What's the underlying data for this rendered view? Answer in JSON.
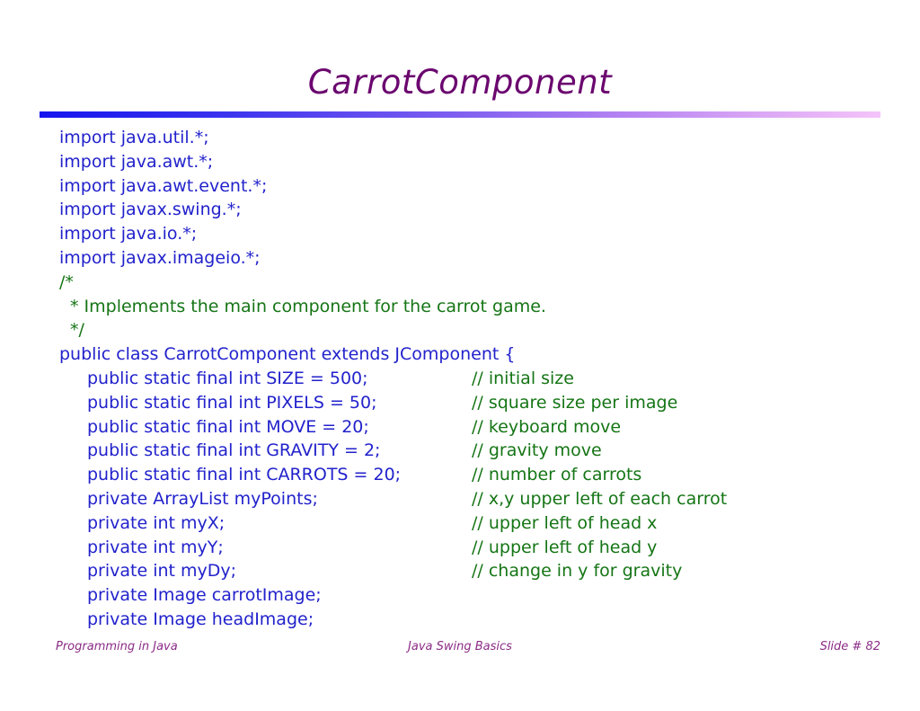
{
  "slide": {
    "title": "CarrotComponent",
    "colors": {
      "title": "#6b066f",
      "code": "#2222cc",
      "comment": "#157515",
      "footer": "#8b2c87",
      "rule_start": "#1414ee",
      "rule_end": "#f4c4fa",
      "background": "#ffffff"
    }
  },
  "code": {
    "lines": [
      {
        "text": "import java.util.*;",
        "indent": 0,
        "kind": "code",
        "comment": ""
      },
      {
        "text": "import java.awt.*;",
        "indent": 0,
        "kind": "code",
        "comment": ""
      },
      {
        "text": "import java.awt.event.*;",
        "indent": 0,
        "kind": "code",
        "comment": ""
      },
      {
        "text": "import javax.swing.*;",
        "indent": 0,
        "kind": "code",
        "comment": ""
      },
      {
        "text": "import java.io.*;",
        "indent": 0,
        "kind": "code",
        "comment": ""
      },
      {
        "text": "import javax.imageio.*;",
        "indent": 0,
        "kind": "code",
        "comment": ""
      },
      {
        "text": "/*",
        "indent": 0,
        "kind": "comment",
        "comment": ""
      },
      {
        "text": "* Implements the main component for the carrot game.",
        "indent": 2,
        "kind": "comment",
        "comment": ""
      },
      {
        "text": "*/",
        "indent": 2,
        "kind": "comment",
        "comment": ""
      },
      {
        "text": "public class CarrotComponent extends JComponent {",
        "indent": 0,
        "kind": "code",
        "comment": ""
      },
      {
        "text": "public static final int SIZE = 500;",
        "indent": 1,
        "kind": "code",
        "comment": "// initial size"
      },
      {
        "text": "public static final int PIXELS = 50;",
        "indent": 1,
        "kind": "code",
        "comment": "// square size per image"
      },
      {
        "text": "public static final int MOVE = 20;",
        "indent": 1,
        "kind": "code",
        "comment": "// keyboard move"
      },
      {
        "text": "public static final int GRAVITY = 2;",
        "indent": 1,
        "kind": "code",
        "comment": "// gravity move"
      },
      {
        "text": "public static final int CARROTS = 20;",
        "indent": 1,
        "kind": "code",
        "comment": "// number of carrots"
      },
      {
        "text": "private ArrayList myPoints;",
        "indent": 1,
        "kind": "code",
        "comment": "// x,y upper left of each carrot"
      },
      {
        "text": "private int myX;",
        "indent": 1,
        "kind": "code",
        "comment": "// upper left of head x"
      },
      {
        "text": "private int myY;",
        "indent": 1,
        "kind": "code",
        "comment": "// upper left of head y"
      },
      {
        "text": "private int myDy;",
        "indent": 1,
        "kind": "code",
        "comment": "// change in y for gravity"
      },
      {
        "text": "private Image carrotImage;",
        "indent": 1,
        "kind": "code",
        "comment": ""
      },
      {
        "text": "private Image headImage;",
        "indent": 1,
        "kind": "code",
        "comment": ""
      }
    ]
  },
  "footer": {
    "left": "Programming in Java",
    "center": "Java Swing Basics",
    "right": "Slide # 82"
  }
}
